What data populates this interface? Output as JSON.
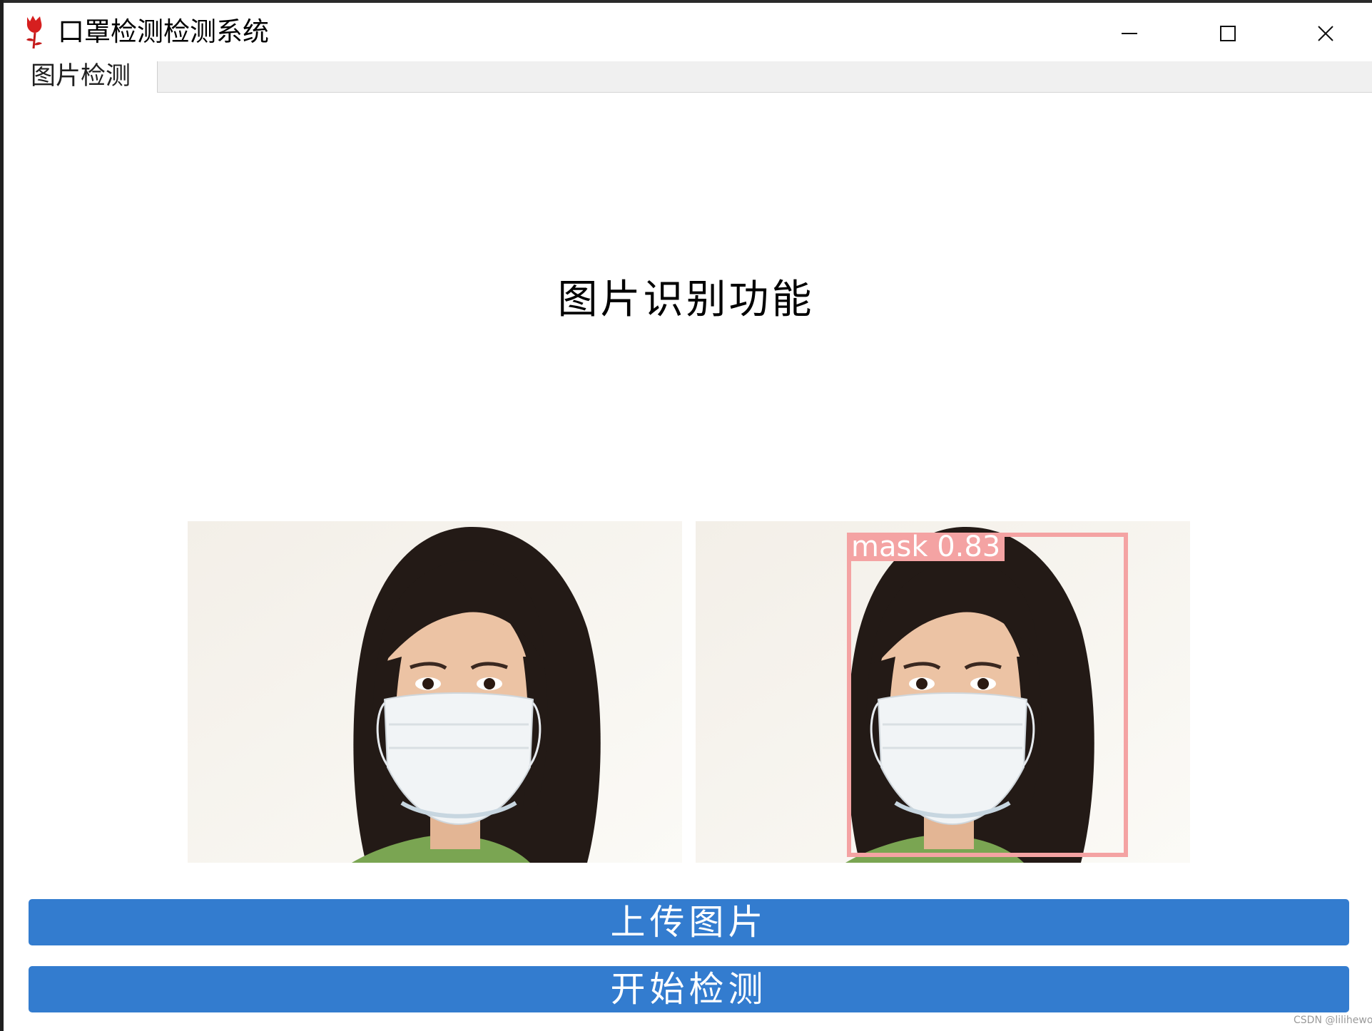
{
  "window": {
    "title": "口罩检测检测系统",
    "icon": "rose-icon",
    "controls": [
      "minimize-icon",
      "maximize-icon",
      "close-icon"
    ]
  },
  "tabs": [
    {
      "label": "图片检测",
      "active": true
    }
  ],
  "main": {
    "heading": "图片识别功能",
    "original_image": {
      "subject": "woman wearing surgical mask"
    },
    "result_image": {
      "subject": "woman wearing surgical mask",
      "detection": {
        "label_text": "mask 0.83",
        "class": "mask",
        "confidence": 0.83
      }
    },
    "buttons": {
      "upload_label": "上传图片",
      "detect_label": "开始检测"
    }
  },
  "watermark": "CSDN @lilihewo",
  "colors": {
    "button_blue": "#337ccf",
    "detection_box": "#f4a3a3",
    "icon_red": "#d61f1f"
  }
}
